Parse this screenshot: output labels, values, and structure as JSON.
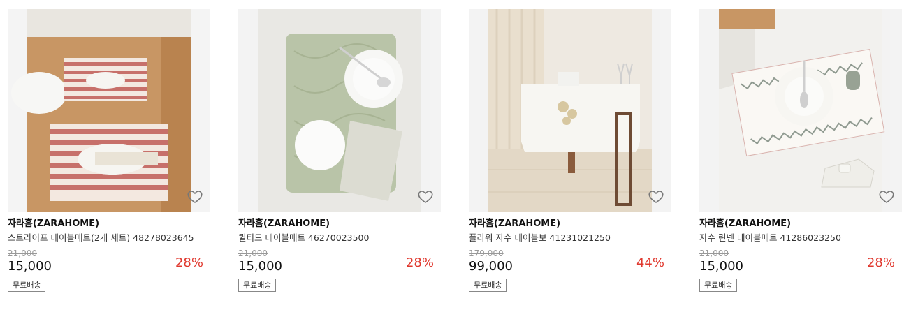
{
  "colors": {
    "discount": "#e0382e",
    "original_price": "#999999"
  },
  "products": [
    {
      "brand": "자라홈(ZARAHOME)",
      "name": "스트라이프 테이블매트(2개 세트) 48278023645",
      "original_price": "21,000",
      "price": "15,000",
      "discount": "28%",
      "shipping": "무료배송",
      "wishlist_icon": "heart-outline-icon"
    },
    {
      "brand": "자라홈(ZARAHOME)",
      "name": "퀼티드 테이블매트 46270023500",
      "original_price": "21,000",
      "price": "15,000",
      "discount": "28%",
      "shipping": "무료배송",
      "wishlist_icon": "heart-outline-icon"
    },
    {
      "brand": "자라홈(ZARAHOME)",
      "name": "플라워 자수 테이블보 41231021250",
      "original_price": "179,000",
      "price": "99,000",
      "discount": "44%",
      "shipping": "무료배송",
      "wishlist_icon": "heart-outline-icon"
    },
    {
      "brand": "자라홈(ZARAHOME)",
      "name": "자수 린넨 테이블매트 41286023250",
      "original_price": "21,000",
      "price": "15,000",
      "discount": "28%",
      "shipping": "무료배송",
      "wishlist_icon": "heart-outline-icon"
    }
  ]
}
